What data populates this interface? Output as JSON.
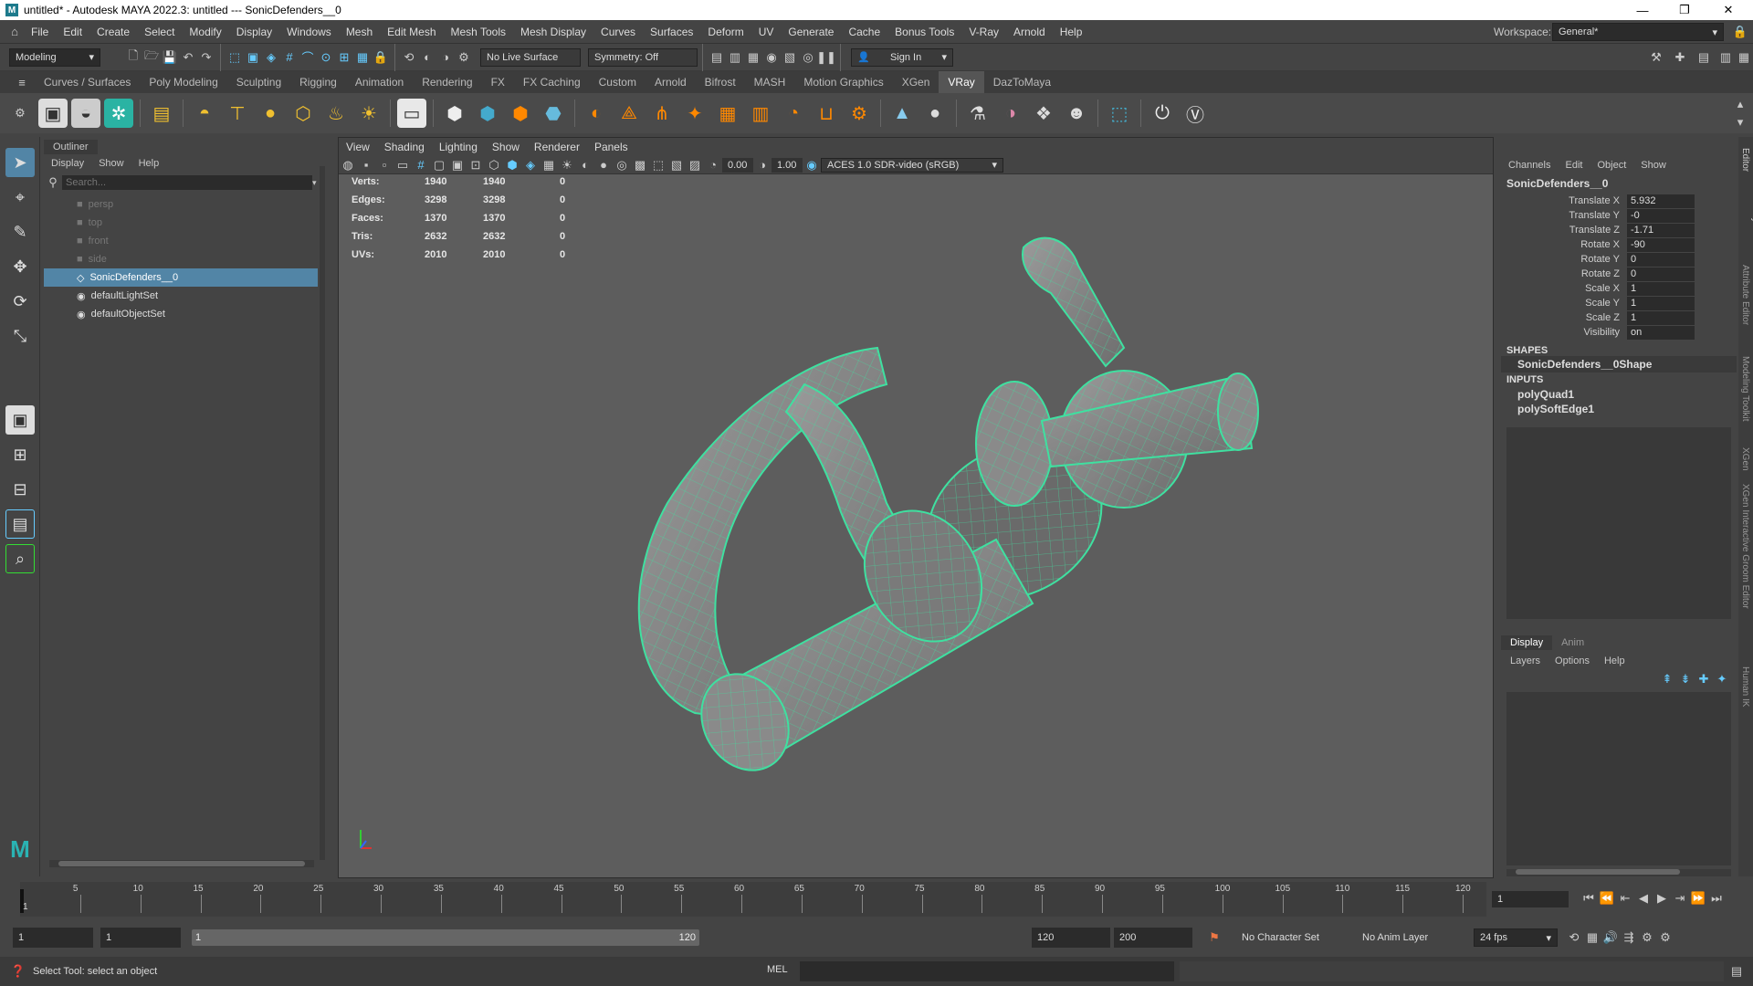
{
  "titlebar": {
    "title": "untitled* - Autodesk MAYA 2022.3: untitled   ---   SonicDefenders__0",
    "logo_text": "M"
  },
  "menu": [
    "File",
    "Edit",
    "Create",
    "Select",
    "Modify",
    "Display",
    "Windows",
    "Mesh",
    "Edit Mesh",
    "Mesh Tools",
    "Mesh Display",
    "Curves",
    "Surfaces",
    "Deform",
    "UV",
    "Generate",
    "Cache",
    "Bonus Tools",
    "V-Ray",
    "Arnold",
    "Help"
  ],
  "workspace": {
    "label": "Workspace:",
    "value": "General*"
  },
  "statusline": {
    "mode": "Modeling",
    "live_surface": "No Live Surface",
    "symmetry": "Symmetry: Off",
    "sign_in": "Sign In"
  },
  "shelf_tabs": [
    "Curves / Surfaces",
    "Poly Modeling",
    "Sculpting",
    "Rigging",
    "Animation",
    "Rendering",
    "FX",
    "FX Caching",
    "Custom",
    "Arnold",
    "Bifrost",
    "MASH",
    "Motion Graphics",
    "XGen",
    "VRay",
    "DazToMaya"
  ],
  "active_shelf_tab": "VRay",
  "outliner": {
    "title": "Outliner",
    "menu": [
      "Display",
      "Show",
      "Help"
    ],
    "search_placeholder": "Search...",
    "items": [
      {
        "label": "persp"
      },
      {
        "label": "top"
      },
      {
        "label": "front"
      },
      {
        "label": "side"
      },
      {
        "label": "SonicDefenders__0"
      },
      {
        "label": "defaultLightSet"
      },
      {
        "label": "defaultObjectSet"
      }
    ]
  },
  "viewport": {
    "menu": [
      "View",
      "Shading",
      "Lighting",
      "Show",
      "Renderer",
      "Panels"
    ],
    "exposure": "0.00",
    "gamma": "1.00",
    "colorspace": "ACES 1.0 SDR-video (sRGB)",
    "hud": [
      {
        "label": "Verts:",
        "a": "1940",
        "b": "1940",
        "c": "0"
      },
      {
        "label": "Edges:",
        "a": "3298",
        "b": "3298",
        "c": "0"
      },
      {
        "label": "Faces:",
        "a": "1370",
        "b": "1370",
        "c": "0"
      },
      {
        "label": "Tris:",
        "a": "2632",
        "b": "2632",
        "c": "0"
      },
      {
        "label": "UVs:",
        "a": "2010",
        "b": "2010",
        "c": "0"
      }
    ]
  },
  "channelbox": {
    "menu": [
      "Channels",
      "Edit",
      "Object",
      "Show"
    ],
    "object": "SonicDefenders__0",
    "attrs": [
      {
        "label": "Translate X",
        "value": "5.932"
      },
      {
        "label": "Translate Y",
        "value": "-0"
      },
      {
        "label": "Translate Z",
        "value": "-1.71"
      },
      {
        "label": "Rotate X",
        "value": "-90"
      },
      {
        "label": "Rotate Y",
        "value": "0"
      },
      {
        "label": "Rotate Z",
        "value": "0"
      },
      {
        "label": "Scale X",
        "value": "1"
      },
      {
        "label": "Scale Y",
        "value": "1"
      },
      {
        "label": "Scale Z",
        "value": "1"
      },
      {
        "label": "Visibility",
        "value": "on"
      }
    ],
    "shapes_header": "SHAPES",
    "shape": "SonicDefenders__0Shape",
    "inputs_header": "INPUTS",
    "inputs": [
      "polyQuad1",
      "polySoftEdge1"
    ]
  },
  "layers": {
    "tabs": [
      "Display",
      "Anim"
    ],
    "menu": [
      "Layers",
      "Options",
      "Help"
    ]
  },
  "right_strip": [
    "Channel Box / Layer Editor",
    "Attribute Editor",
    "Modeling Toolkit",
    "XGen",
    "XGen Interactive Groom Editor",
    "Human IK"
  ],
  "timeline": {
    "ticks": [
      "5",
      "10",
      "15",
      "20",
      "25",
      "30",
      "35",
      "40",
      "45",
      "50",
      "55",
      "60",
      "65",
      "70",
      "75",
      "80",
      "85",
      "90",
      "95",
      "100",
      "105",
      "110",
      "115",
      "120"
    ],
    "current_frame": "1",
    "current_frame_field": "1"
  },
  "range": {
    "start": "1",
    "start2": "1",
    "slider_start": "1",
    "slider_end": "120",
    "end": "120",
    "end2": "200",
    "character_set": "No Character Set",
    "anim_layer": "No Anim Layer",
    "fps": "24 fps"
  },
  "cmdline": {
    "help": "Select Tool: select an object",
    "lang": "MEL"
  },
  "colors": {
    "wire": "#3fe0a0",
    "selected": "#5285a6",
    "accent": "#1d7a8c"
  }
}
